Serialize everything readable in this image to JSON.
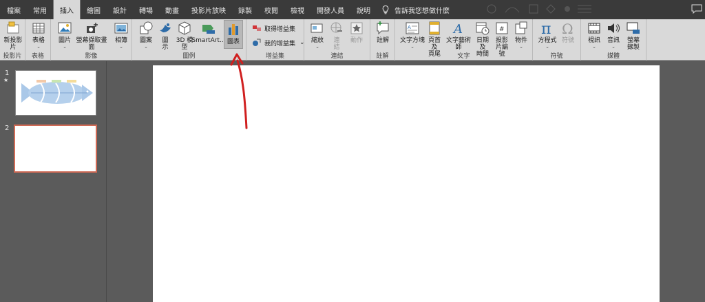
{
  "tabs": [
    {
      "label": "檔案"
    },
    {
      "label": "常用"
    },
    {
      "label": "插入"
    },
    {
      "label": "繪圖"
    },
    {
      "label": "設計"
    },
    {
      "label": "轉場"
    },
    {
      "label": "動畫"
    },
    {
      "label": "投影片放映"
    },
    {
      "label": "錄製"
    },
    {
      "label": "校閱"
    },
    {
      "label": "檢視"
    },
    {
      "label": "開發人員"
    },
    {
      "label": "說明"
    }
  ],
  "active_tab": "插入",
  "tell_me": "告訴我您想做什麼",
  "ribbon": {
    "slides": {
      "label": "投影片",
      "new_slide_1": "新投影",
      "new_slide_2": "片"
    },
    "tables": {
      "label": "表格",
      "table": "表格"
    },
    "images": {
      "label": "影像",
      "pictures": "圖片",
      "screenshot": "螢幕擷取畫面",
      "album": "相簿"
    },
    "illustrations": {
      "label": "圖例",
      "shapes": "圖案",
      "icons_1": "圖",
      "icons_2": "示",
      "model3d_1": "3D 模",
      "model3d_2": "型",
      "smartart": "SmartArt...",
      "chart": "圖表"
    },
    "addins": {
      "label": "增益集",
      "get_addins": "取得增益集",
      "my_addins": "我的增益集"
    },
    "links": {
      "label": "連結",
      "zoom": "縮放",
      "link_1": "連",
      "link_2": "結",
      "action": "動作"
    },
    "comments": {
      "label": "註解",
      "comment": "註解"
    },
    "text": {
      "label": "文字",
      "textbox": "文字方塊",
      "header_1": "頁首及",
      "header_2": "頁尾",
      "wordart": "文字藝術師",
      "datetime_1": "日期及",
      "datetime_2": "時間",
      "slidenum_1": "投影",
      "slidenum_2": "片編號",
      "object": "物件"
    },
    "symbols": {
      "label": "符號",
      "equation": "方程式",
      "symbol": "符號"
    },
    "media": {
      "label": "媒體",
      "video": "視訊",
      "audio": "音訊",
      "screenrec_1": "螢幕",
      "screenrec_2": "錄製"
    }
  },
  "slides": [
    {
      "number": "1",
      "star": "★"
    },
    {
      "number": "2"
    }
  ],
  "colors": {
    "accent_arrow": "#d01f1f",
    "active_slide_border": "#d06a55",
    "chart_icon_bar": "#2e6ca8",
    "chart_icon_bar2": "#e09a2c"
  }
}
